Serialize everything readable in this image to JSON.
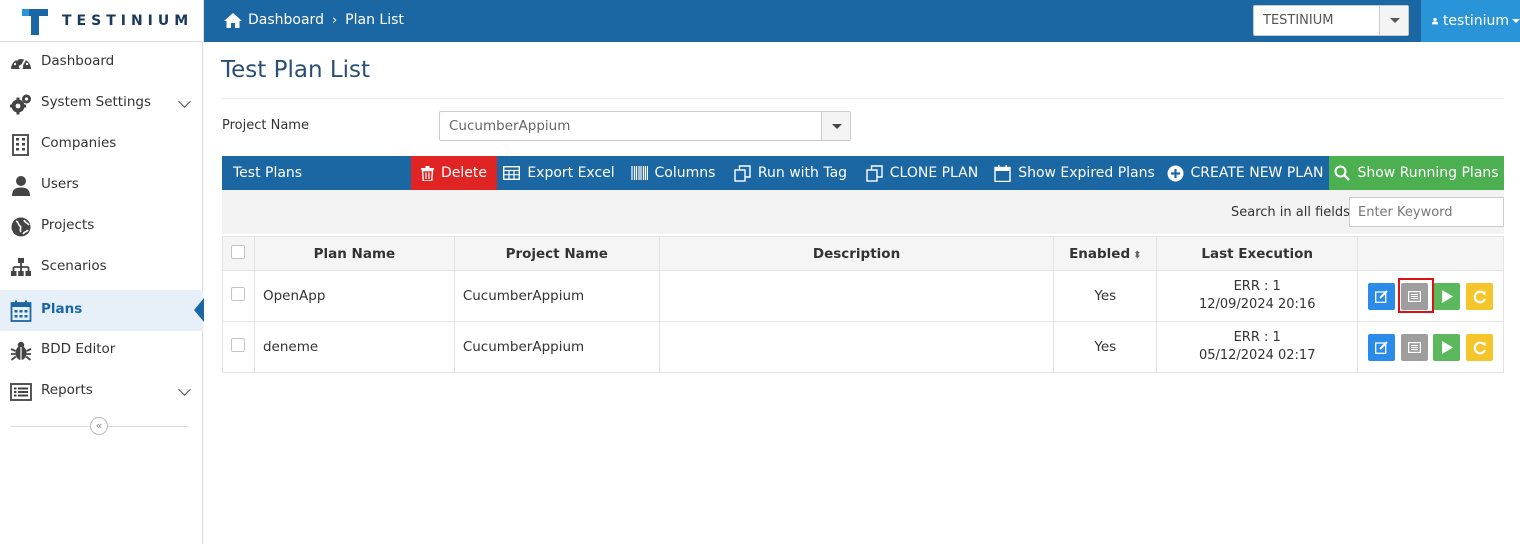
{
  "app": {
    "brand": "TESTINIUM"
  },
  "breadcrumb": {
    "home": "Dashboard",
    "current": "Plan List"
  },
  "header": {
    "project_select": "TESTINIUM",
    "user": "testinium"
  },
  "sidebar": {
    "items": [
      {
        "label": "Dashboard",
        "icon": "dashboard-icon"
      },
      {
        "label": "System Settings",
        "icon": "gears-icon",
        "expandable": true
      },
      {
        "label": "Companies",
        "icon": "building-icon"
      },
      {
        "label": "Users",
        "icon": "user-icon"
      },
      {
        "label": "Projects",
        "icon": "globe-icon"
      },
      {
        "label": "Scenarios",
        "icon": "sitemap-icon"
      },
      {
        "label": "Plans",
        "icon": "calendar-icon",
        "active": true
      },
      {
        "label": "BDD Editor",
        "icon": "bug-icon"
      },
      {
        "label": "Reports",
        "icon": "list-icon",
        "expandable": true
      }
    ],
    "collapse": "«"
  },
  "page": {
    "title": "Test Plan List",
    "project_label": "Project Name",
    "project_value": "CucumberAppium"
  },
  "toolbar": {
    "title": "Test Plans",
    "buttons": {
      "delete": "Delete",
      "export": "Export Excel",
      "columns": "Columns",
      "run_tag": "Run with Tag",
      "clone": "CLONE PLAN",
      "expired": "Show Expired Plans",
      "create": "CREATE NEW PLAN",
      "running": "Show Running Plans"
    }
  },
  "search": {
    "label": "Search in all fields:",
    "placeholder": "Enter Keyword",
    "value": ""
  },
  "table": {
    "headers": {
      "plan": "Plan Name",
      "project": "Project Name",
      "desc": "Description",
      "enabled": "Enabled",
      "last": "Last Execution"
    },
    "rows": [
      {
        "plan": "OpenApp",
        "project": "CucumberAppium",
        "desc": "",
        "enabled": "Yes",
        "status": "ERR : 1",
        "date": "12/09/2024 20:16"
      },
      {
        "plan": "deneme",
        "project": "CucumberAppium",
        "desc": "",
        "enabled": "Yes",
        "status": "ERR : 1",
        "date": "05/12/2024 02:17"
      }
    ]
  },
  "colors": {
    "primary": "#1b67a3",
    "danger": "#e02424",
    "success": "#4caf50",
    "accent": "#2a94d8"
  }
}
